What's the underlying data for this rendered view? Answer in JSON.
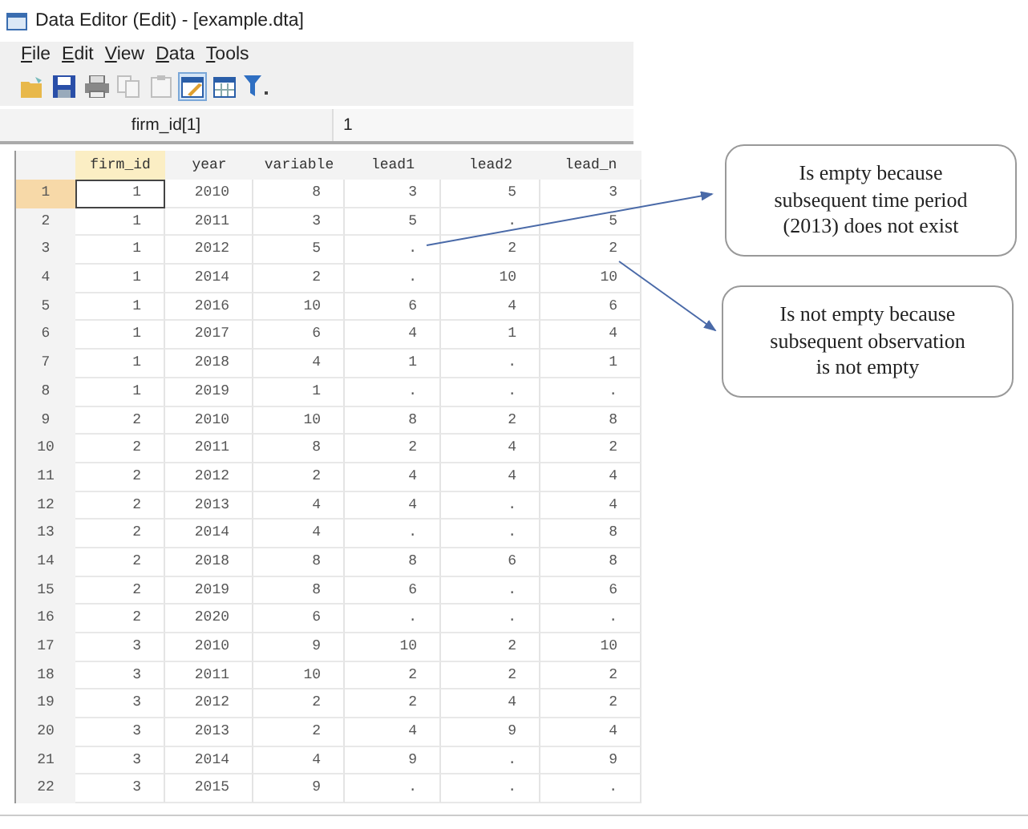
{
  "window": {
    "title": "Data Editor (Edit) - [example.dta]"
  },
  "menu": [
    "File",
    "Edit",
    "View",
    "Data",
    "Tools"
  ],
  "toolbar": [
    {
      "kind": "open",
      "selected": false,
      "disabled": false
    },
    {
      "kind": "save",
      "selected": false,
      "disabled": false
    },
    {
      "kind": "print",
      "selected": false,
      "disabled": false
    },
    {
      "kind": "copy",
      "selected": false,
      "disabled": true
    },
    {
      "kind": "paste",
      "selected": false,
      "disabled": true
    },
    {
      "kind": "edit",
      "selected": true,
      "disabled": false
    },
    {
      "kind": "browse",
      "selected": false,
      "disabled": false
    },
    {
      "kind": "filter",
      "selected": false,
      "disabled": false
    }
  ],
  "cell_editor": {
    "label": "firm_id[1]",
    "value": "1"
  },
  "table": {
    "columns": [
      {
        "label": "firm_id",
        "selected": true
      },
      {
        "label": "year",
        "selected": false
      },
      {
        "label": "variable",
        "selected": false
      },
      {
        "label": "lead1",
        "selected": false
      },
      {
        "label": "lead2",
        "selected": false
      },
      {
        "label": "lead_n",
        "selected": false
      }
    ],
    "rows": [
      {
        "number": "1",
        "selected": true,
        "cells": [
          "1",
          "2010",
          "8",
          "3",
          "5",
          "3"
        ]
      },
      {
        "number": "2",
        "selected": false,
        "cells": [
          "1",
          "2011",
          "3",
          "5",
          ".",
          "5"
        ]
      },
      {
        "number": "3",
        "selected": false,
        "cells": [
          "1",
          "2012",
          "5",
          ".",
          "2",
          "2"
        ]
      },
      {
        "number": "4",
        "selected": false,
        "cells": [
          "1",
          "2014",
          "2",
          ".",
          "10",
          "10"
        ]
      },
      {
        "number": "5",
        "selected": false,
        "cells": [
          "1",
          "2016",
          "10",
          "6",
          "4",
          "6"
        ]
      },
      {
        "number": "6",
        "selected": false,
        "cells": [
          "1",
          "2017",
          "6",
          "4",
          "1",
          "4"
        ]
      },
      {
        "number": "7",
        "selected": false,
        "cells": [
          "1",
          "2018",
          "4",
          "1",
          ".",
          "1"
        ]
      },
      {
        "number": "8",
        "selected": false,
        "cells": [
          "1",
          "2019",
          "1",
          ".",
          ".",
          "."
        ]
      },
      {
        "number": "9",
        "selected": false,
        "cells": [
          "2",
          "2010",
          "10",
          "8",
          "2",
          "8"
        ]
      },
      {
        "number": "10",
        "selected": false,
        "cells": [
          "2",
          "2011",
          "8",
          "2",
          "4",
          "2"
        ]
      },
      {
        "number": "11",
        "selected": false,
        "cells": [
          "2",
          "2012",
          "2",
          "4",
          "4",
          "4"
        ]
      },
      {
        "number": "12",
        "selected": false,
        "cells": [
          "2",
          "2013",
          "4",
          "4",
          ".",
          "4"
        ]
      },
      {
        "number": "13",
        "selected": false,
        "cells": [
          "2",
          "2014",
          "4",
          ".",
          ".",
          "8"
        ]
      },
      {
        "number": "14",
        "selected": false,
        "cells": [
          "2",
          "2018",
          "8",
          "8",
          "6",
          "8"
        ]
      },
      {
        "number": "15",
        "selected": false,
        "cells": [
          "2",
          "2019",
          "8",
          "6",
          ".",
          "6"
        ]
      },
      {
        "number": "16",
        "selected": false,
        "cells": [
          "2",
          "2020",
          "6",
          ".",
          ".",
          "."
        ]
      },
      {
        "number": "17",
        "selected": false,
        "cells": [
          "3",
          "2010",
          "9",
          "10",
          "2",
          "10"
        ]
      },
      {
        "number": "18",
        "selected": false,
        "cells": [
          "3",
          "2011",
          "10",
          "2",
          "2",
          "2"
        ]
      },
      {
        "number": "19",
        "selected": false,
        "cells": [
          "3",
          "2012",
          "2",
          "2",
          "4",
          "2"
        ]
      },
      {
        "number": "20",
        "selected": false,
        "cells": [
          "3",
          "2013",
          "2",
          "4",
          "9",
          "4"
        ]
      },
      {
        "number": "21",
        "selected": false,
        "cells": [
          "3",
          "2014",
          "4",
          "9",
          ".",
          "9"
        ]
      },
      {
        "number": "22",
        "selected": false,
        "cells": [
          "3",
          "2015",
          "9",
          ".",
          ".",
          "."
        ]
      }
    ]
  },
  "callouts": [
    "Is empty because subsequent time period (2013) does not exist",
    "Is not empty because subsequent observation is not empty"
  ]
}
